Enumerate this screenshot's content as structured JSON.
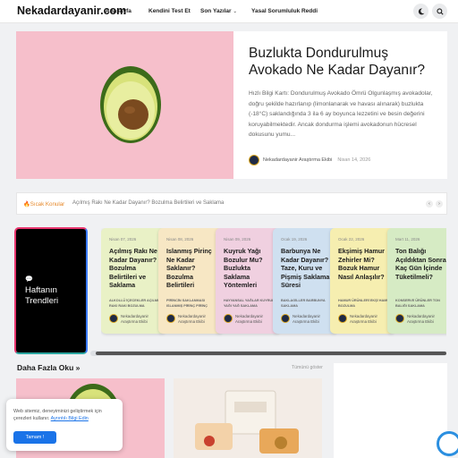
{
  "header": {
    "logo": "Nekadardayanir.com",
    "nav": [
      "Anasayfa",
      "Kendini Test Et",
      "Son Yazılar",
      "Yasal Sorumluluk Reddi"
    ],
    "nav_dropdown_icon": "chevron-down-icon",
    "actions": [
      "moon-icon",
      "search-icon"
    ]
  },
  "hero": {
    "title": "Buzlukta Dondurulmuş Avokado Ne Kadar Dayanır?",
    "excerpt": "Hızlı Bilgi Kartı: Dondurulmuş Avokado Ömrü Olgunlaşmış avokadolar, doğru şekilde hazırlanıp (limonlanarak ve havası alınarak) buzlukta (-18°C) saklandığında 3 ila 6 ay boyunca lezzetini ve besin değerini koruyabilmektedir. Ancak dondurma işlemi avokadonun hücresel dokusunu yumu...",
    "author": "Nekadardayanir Araştırma Ekibi",
    "date": "Nisan 14, 2026"
  },
  "ticker": {
    "label": "Sıcak Konular",
    "text": "Açılmış Rakı Ne Kadar Dayanır? Bozulma Belirtileri ve Saklama",
    "icon": "fire-icon",
    "prev_icon": "chevron-left-icon",
    "next_icon": "chevron-right-icon"
  },
  "trending": {
    "title": "Haftanın Trendleri",
    "icon": "chat-icon"
  },
  "cards": [
    {
      "date": "Nisan 07, 2026",
      "title": "Açılmış Rakı Ne Kadar Dayanır? Bozulma Belirtileri ve Saklama",
      "tags": "ALKOLLÜ İÇECEKLER   AÇILMIŞ RAKI   RAKI BOZULMA",
      "author": "Nekadardayanir Araştırma Ekibi",
      "color": "#e9f1c6"
    },
    {
      "date": "Nisan 08, 2026",
      "title": "Islanmış Pirinç Ne Kadar Saklanır? Bozulma Belirtileri",
      "tags": "PİRİNCİN SAKLANMASI   ISLANMIŞ PİRİNÇ   PİRİNÇ",
      "author": "Nekadardayanir Araştırma Ekibi",
      "color": "#f7e7c4"
    },
    {
      "date": "Nisan 09, 2026",
      "title": "Kuyruk Yağı Bozulur Mu? Buzlukta Saklama Yöntemleri",
      "tags": "HAYVANSAL YAĞLAR   KUYRUK YAĞI   YAĞ SAKLAMA",
      "author": "Nekadardayanir Araştırma Ekibi",
      "color": "#f0d0e0"
    },
    {
      "date": "Ocak 19, 2026",
      "title": "Barbunya Ne Kadar Dayanır? Taze, Kuru ve Pişmiş Saklama Süresi",
      "tags": "BAKLAGİLLER   BARBUNYA   SAKLAMA",
      "author": "Nekadardayanir Araştırma Ekibi",
      "color": "#cfe0f0"
    },
    {
      "date": "Ocak 22, 2026",
      "title": "Ekşimiş Hamur Zehirler Mi? Bozuk Hamur Nasıl Anlaşılır?",
      "tags": "HAMUR ÜRÜNLERİ   EKŞİ HAMUR   BOZULMA",
      "author": "Nekadardayanir Araştırma Ekibi",
      "color": "#f6eeb0"
    },
    {
      "date": "Mart 11, 2026",
      "title": "Ton Balığı Açıldıktan Sonra Kaç Gün İçinde Tüketilmeli?",
      "tags": "KONSERVE ÜRÜNLER   TON BALIĞI   SAKLAMA",
      "author": "Nekadardayanir Araştırma Ekibi",
      "color": "#d6ebc4"
    }
  ],
  "more": {
    "title": "Daha Fazla Oku »",
    "link": "Tümünü göster"
  },
  "cookie": {
    "text": "Web sitemiz, deneyiminizi geliştirmek için çerezleri kullanır.",
    "link": "Ayrıntılı Bilgi Edin",
    "button": "Tamam !"
  },
  "colors": {
    "accent": "#1a73e8",
    "ticker_label": "#e6892b",
    "hero_bg": "#f6bfcb"
  }
}
